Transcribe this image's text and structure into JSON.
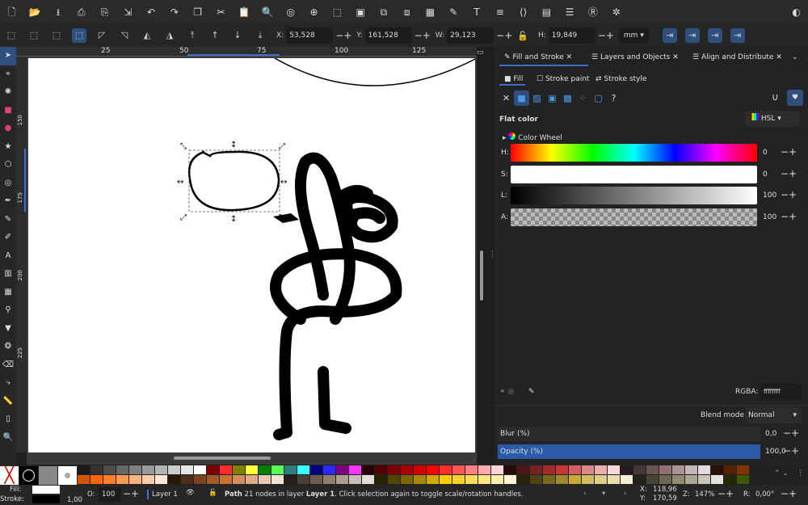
{
  "toolbar_commands": [
    {
      "icon": "new-document-icon",
      "g": "🗋"
    },
    {
      "icon": "open-icon",
      "g": "📂"
    },
    {
      "icon": "save-icon",
      "g": "⭳"
    },
    {
      "icon": "print-icon",
      "g": "⎙"
    },
    {
      "icon": "import-icon",
      "g": "⎘"
    },
    {
      "icon": "export-icon",
      "g": "⇲"
    },
    {
      "icon": "undo-icon",
      "g": "↶"
    },
    {
      "icon": "redo-icon",
      "g": "↷"
    },
    {
      "icon": "copy-icon",
      "g": "❐"
    },
    {
      "icon": "cut-icon",
      "g": "✂"
    },
    {
      "icon": "paste-icon",
      "g": "📋"
    },
    {
      "icon": "zoom-selection-icon",
      "g": "🔍"
    },
    {
      "icon": "zoom-drawing-icon",
      "g": "◎"
    },
    {
      "icon": "zoom-page-icon",
      "g": "⊕"
    },
    {
      "icon": "zoom-fit-icon",
      "g": "⬚"
    },
    {
      "icon": "duplicate-icon",
      "g": "▣"
    },
    {
      "icon": "clone-icon",
      "g": "⧉"
    },
    {
      "icon": "unlink-clone-icon",
      "g": "⧈"
    },
    {
      "icon": "group-icon",
      "g": "▦"
    },
    {
      "icon": "fill-stroke-icon",
      "g": "✎"
    },
    {
      "icon": "text-font-icon",
      "g": "T"
    },
    {
      "icon": "layers-icon",
      "g": "≡"
    },
    {
      "icon": "xml-editor-icon",
      "g": "⟨⟩"
    },
    {
      "icon": "swatches-icon",
      "g": "▤"
    },
    {
      "icon": "align-icon",
      "g": "☰"
    },
    {
      "icon": "find-icon",
      "g": "Ⓡ"
    },
    {
      "icon": "preferences-icon",
      "g": "✲"
    }
  ],
  "select_toolbar": {
    "icons": [
      "select-all-icon",
      "select-all-layers-icon",
      "deselect-icon",
      "touch-select-icon",
      "rotate-ccw-icon",
      "rotate-cw-icon",
      "flip-horizontal-icon",
      "flip-vertical-icon",
      "raise-top-icon",
      "raise-icon",
      "lower-icon",
      "lower-bottom-icon"
    ],
    "x_label": "X:",
    "x": "53,528",
    "y_label": "Y:",
    "y": "161,528",
    "w_label": "W:",
    "w": "29,123",
    "h_label": "H:",
    "h": "19,849",
    "unit": "mm",
    "transform_icons": [
      "scale-stroke-icon",
      "scale-corners-icon",
      "move-gradients-icon",
      "move-patterns-icon"
    ]
  },
  "tools": [
    "selector-tool-icon",
    "node-tool-icon",
    "tweak-tool-icon",
    "rectangle-tool-icon",
    "circle-tool-icon",
    "star-tool-icon",
    "3d-box-tool-icon",
    "spiral-tool-icon",
    "pen-tool-icon",
    "pencil-tool-icon",
    "calligraphy-tool-icon",
    "text-tool-icon",
    "gradient-tool-icon",
    "mesh-tool-icon",
    "dropper-tool-icon",
    "paint-bucket-tool-icon",
    "spray-tool-icon",
    "eraser-tool-icon",
    "connector-tool-icon",
    "measure-tool-icon",
    "pages-tool-icon",
    "zoom-tool-icon"
  ],
  "ruler": {
    "top": [
      "25",
      "50",
      "75",
      "100",
      "125"
    ],
    "left": [
      "150",
      "175",
      "200",
      "225"
    ]
  },
  "panel": {
    "tabs": [
      {
        "label": "Fill and Stroke",
        "active": true
      },
      {
        "label": "Layers and Objects"
      },
      {
        "label": "Align and Distribute"
      }
    ],
    "subtabs": [
      "Fill",
      "Stroke paint",
      "Stroke style"
    ],
    "paint_types": [
      "no-paint-icon",
      "flat-color-icon",
      "linear-gradient-icon",
      "radial-gradient-icon",
      "mesh-gradient-icon",
      "pattern-icon",
      "swatch-icon",
      "unset-icon"
    ],
    "unset_label": "?",
    "flat_color": "Flat color",
    "mode": "HSL",
    "color_wheel": "Color Wheel",
    "sliders": [
      {
        "label": "H:",
        "value": "0"
      },
      {
        "label": "S:",
        "value": "0"
      },
      {
        "label": "L:",
        "value": "100"
      },
      {
        "label": "A:",
        "value": "100"
      }
    ],
    "rgba_label": "RGBA:",
    "rgba": "ffffffff",
    "blend_label": "Blend mode:",
    "blend": "Normal",
    "blur_label": "Blur (%)",
    "blur": "0,0",
    "opacity_label": "Opacity (%)",
    "opacity": "100,0",
    "accent": "#2a5aa8"
  },
  "palette": {
    "row1": [
      "#1a1a1a",
      "#333333",
      "#4d4d4d",
      "#666666",
      "#808080",
      "#999999",
      "#b3b3b3",
      "#cccccc",
      "#e6e6e6",
      "#ffffff",
      "#800000",
      "#ff2a2a",
      "#808000",
      "#ffff33",
      "#008000",
      "#55ff55",
      "#2a7f7f",
      "#33ffff",
      "#000080",
      "#2a2aff",
      "#800080",
      "#ff33ff",
      "#2b0000",
      "#550000",
      "#800000",
      "#aa0000",
      "#d40000",
      "#ff0000",
      "#ff2a2a",
      "#ff5555",
      "#ff8080",
      "#ffaaaa",
      "#ffd5d5",
      "#280b0b",
      "#501616",
      "#782121",
      "#a02c2c",
      "#c83737",
      "#d35f5f",
      "#de8787",
      "#e9afaf",
      "#f4d7d7",
      "#241c1c",
      "#483737",
      "#6c5353",
      "#916f6f",
      "#ac9393",
      "#c8b7b7",
      "#e3dbdb",
      "#2b1100",
      "#552200",
      "#803300"
    ],
    "row2": [
      "#d45500",
      "#ff6600",
      "#ff7f2a",
      "#ff9955",
      "#ffb380",
      "#ffccaa",
      "#ffe6d5",
      "#28170b",
      "#502d16",
      "#784421",
      "#a05a2c",
      "#c87137",
      "#d38d5f",
      "#deaa87",
      "#e9c6af",
      "#f4e3d7",
      "#241f1c",
      "#483e37",
      "#6c5d53",
      "#917c6f",
      "#ac9d93",
      "#c8beb7",
      "#e3dedb",
      "#2b2200",
      "#554400",
      "#806600",
      "#aa8800",
      "#d4aa00",
      "#ffcc00",
      "#ffd42a",
      "#ffdd55",
      "#ffe680",
      "#ffeeaa",
      "#fff6d5",
      "#28220b",
      "#504416",
      "#786721",
      "#a0892c",
      "#c8ab37",
      "#d3bc5f",
      "#decd87",
      "#e9ddaf",
      "#f4eed7",
      "#24221c",
      "#484537",
      "#6c6753",
      "#918a6f",
      "#aca793",
      "#c8c4b7",
      "#e3e2db",
      "#222b00",
      "#445500"
    ]
  },
  "status": {
    "fill_label": "Fill:",
    "stroke_label": "Stroke:",
    "stroke_width": "1,00",
    "opacity_label": "O:",
    "opacity": "100",
    "layer": "Layer 1",
    "message_bold": "Path",
    "message": " 21 nodes in layer ",
    "message_layer": "Layer 1",
    "message_end": ". Click selection again to toggle scale/rotation handles.",
    "x_label": "X:",
    "x": "118,96",
    "y_label": "Y:",
    "y": "170,59",
    "zoom_label": "Z:",
    "zoom": "147%",
    "rotate_label": "R:",
    "rotate": "0,00°"
  }
}
